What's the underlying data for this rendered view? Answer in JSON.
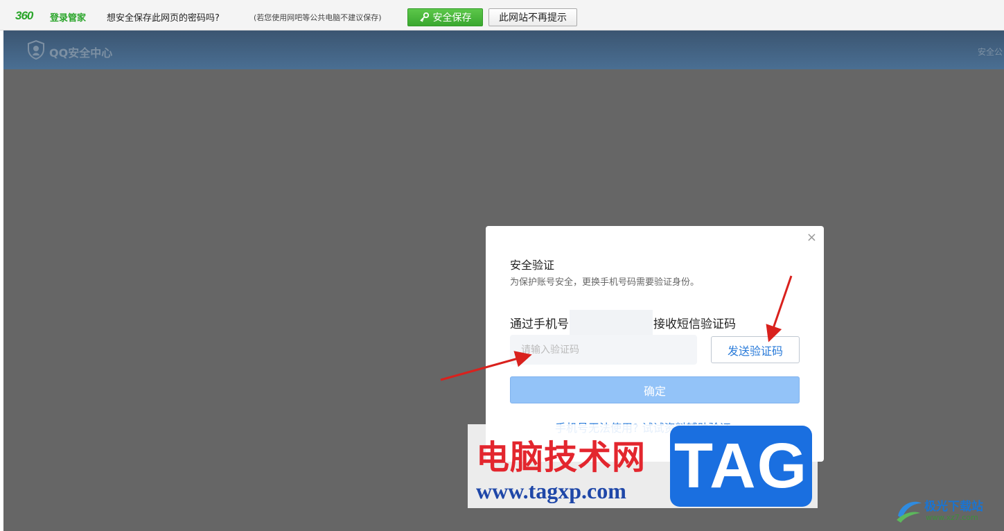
{
  "password_bar": {
    "logo": "360",
    "brand": "登录管家",
    "question": "想安全保存此网页的密码吗?",
    "note": "(若您使用网吧等公共电脑不建议保存)",
    "save_label": "安全保存",
    "never_label": "此网站不再提示",
    "icons": {
      "key": "key-icon"
    }
  },
  "site_header": {
    "title": "QQ安全中心",
    "right_link": "安全公",
    "icons": {
      "logo": "shield-icon"
    }
  },
  "dialog": {
    "title": "安全验证",
    "subtitle": "为保护账号安全，更换手机号码需要验证身份。",
    "phone_prefix": "通过手机号",
    "phone_suffix": "接收短信验证码",
    "code_placeholder": "请输入验证码",
    "send_label": "发送验证码",
    "confirm_label": "确定",
    "alt_link": "手机号无法使用? 试试资料辅助验证",
    "close_symbol": "×"
  },
  "watermark": {
    "cn_text": "电脑技术网",
    "url": "www.tagxp.com",
    "tag": "TAG"
  },
  "corner_logo": {
    "text": "极光下载站",
    "small": "www.xz7.com"
  },
  "colors": {
    "accent": "#2a7bd9",
    "overlay": "#666666",
    "arrow": "#d9211d"
  }
}
